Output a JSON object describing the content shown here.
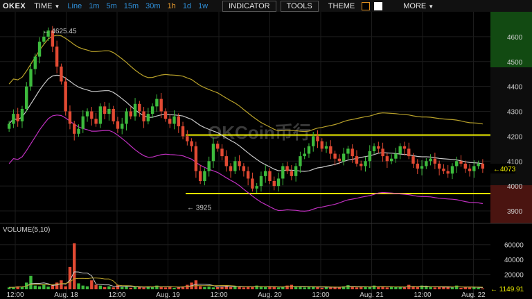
{
  "toolbar": {
    "logo": "OKEX",
    "time_label": "TIME",
    "intervals": [
      "Line",
      "1m",
      "5m",
      "15m",
      "30m",
      "1h",
      "1d",
      "1w"
    ],
    "active_interval": "1h",
    "indicator_label": "INDICATOR",
    "tools_label": "TOOLS",
    "theme_label": "THEME",
    "more_label": "MORE",
    "theme_colors": [
      "#000000",
      "#ffffff"
    ]
  },
  "watermark": "OKCoin币行",
  "colors": {
    "up": "#3dbb3d",
    "down": "#e24a33",
    "ma_white": "#c8c8c8",
    "band_upper": "#b8a12a",
    "band_lower": "#c030c0",
    "hline": "#f2f200"
  },
  "chart_data": {
    "type": "candlestick",
    "price_axis": {
      "ticks": [
        3900,
        4000,
        4100,
        4200,
        4300,
        4400,
        4500,
        4600
      ],
      "min": 3850,
      "max": 4700
    },
    "time_axis": {
      "labels": [
        "12:00",
        "Aug. 18",
        "12:00",
        "Aug. 19",
        "12:00",
        "Aug. 20",
        "12:00",
        "Aug. 21",
        "12:00",
        "Aug. 22"
      ]
    },
    "last_price": "4073",
    "high_label": "← 4625.45",
    "low_label": "← 3925",
    "horizontal_lines": [
      4205,
      3970
    ],
    "closes": [
      4250,
      4290,
      4260,
      4310,
      4400,
      4470,
      4520,
      4580,
      4600,
      4625,
      4560,
      4480,
      4420,
      4300,
      4250,
      4210,
      4230,
      4280,
      4300,
      4270,
      4250,
      4320,
      4290,
      4310,
      4260,
      4230,
      4250,
      4300,
      4280,
      4330,
      4300,
      4260,
      4290,
      4320,
      4350,
      4300,
      4270,
      4250,
      4280,
      4240,
      4200,
      4180,
      4160,
      4060,
      4020,
      4060,
      4100,
      4170,
      4150,
      4120,
      4080,
      4060,
      4100,
      4080,
      4060,
      4030,
      3990,
      4000,
      4040,
      4060,
      4020,
      4000,
      4030,
      4080,
      4060,
      4040,
      4080,
      4120,
      4130,
      4160,
      4200,
      4180,
      4150,
      4160,
      4130,
      4110,
      4100,
      4130,
      4150,
      4120,
      4090,
      4080,
      4100,
      4140,
      4160,
      4150,
      4120,
      4100,
      4110,
      4130,
      4160,
      4150,
      4120,
      4090,
      4070,
      4080,
      4100,
      4110,
      4090,
      4070,
      4060,
      4050,
      4080,
      4100,
      4090,
      4070,
      4060,
      4080,
      4090,
      4070
    ],
    "volume_axis": {
      "label": "VOLUME(5,10)",
      "ticks": [
        20000,
        40000,
        60000
      ],
      "max": 70000
    },
    "volume_last": "← 1149.91",
    "volumes": [
      2500,
      3000,
      4000,
      3500,
      9000,
      18000,
      5000,
      4000,
      7000,
      3500,
      6000,
      9000,
      12000,
      4000,
      30000,
      62000,
      8000,
      5000,
      4000,
      12000,
      6000,
      5000,
      3000,
      4000,
      2500,
      6000,
      3000,
      4000,
      2000,
      3500,
      3000,
      2500,
      4000,
      3000,
      5000,
      3000,
      2500,
      4000,
      2000,
      3000,
      4000,
      6000,
      9000,
      12000,
      4000,
      3000,
      3500,
      2500,
      3000,
      4000,
      5000,
      3000,
      4500,
      3000,
      2500,
      4000,
      3000,
      5000,
      3500,
      3000,
      4000,
      3000,
      2500,
      3000,
      5000,
      6000,
      3000,
      3000,
      2500,
      3500,
      4000,
      3000,
      2000,
      3000,
      2500,
      3500,
      3000,
      4000,
      5500,
      3000,
      2500,
      3000,
      3500,
      3000,
      5000,
      3000,
      4000,
      2500,
      3000,
      3500,
      3000,
      2500,
      6000,
      4000,
      3000,
      5000,
      3500,
      3000,
      2500,
      3000,
      3500,
      3000,
      2500,
      5000,
      2000,
      3000,
      2500,
      3000,
      2000,
      1150
    ]
  }
}
